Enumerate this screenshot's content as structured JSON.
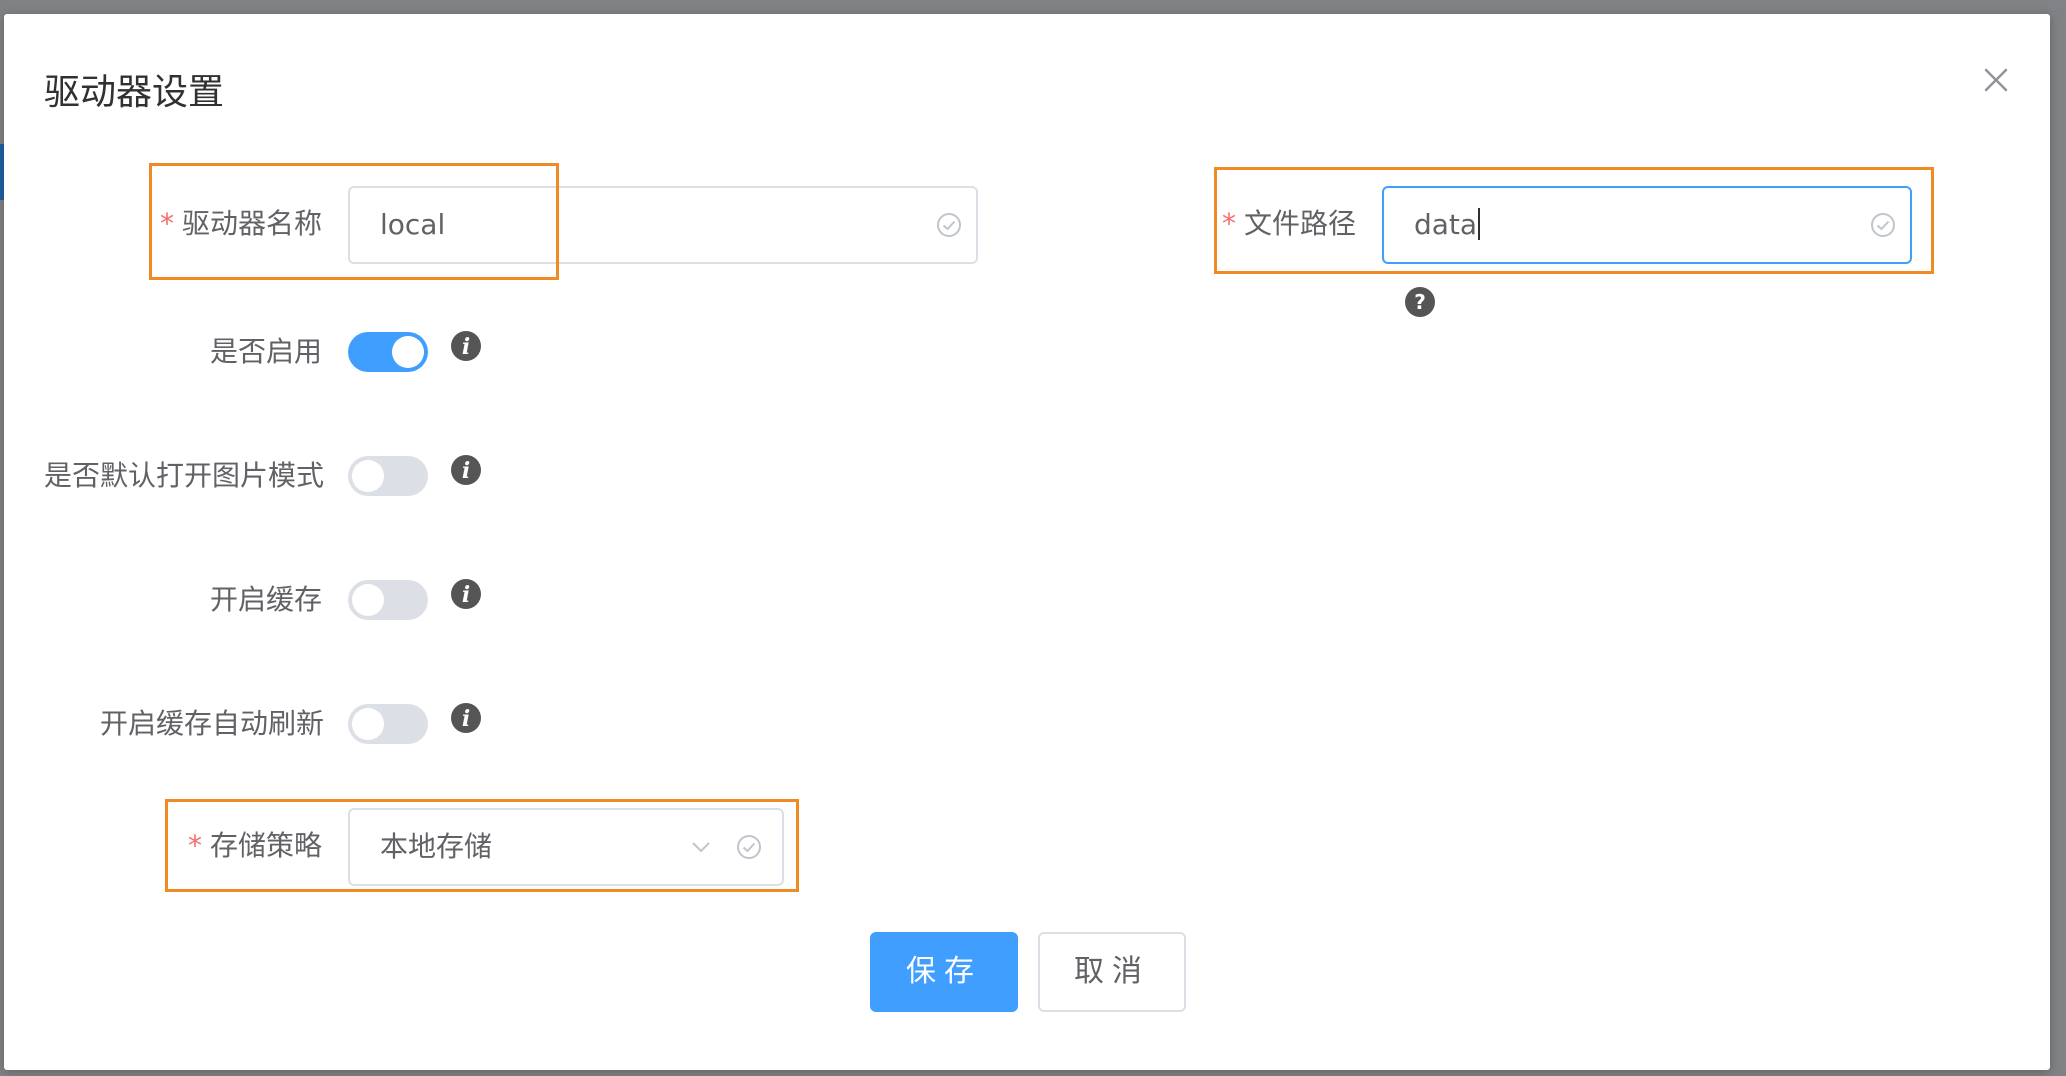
{
  "dialog": {
    "title": "驱动器设置",
    "close_icon": "close-icon"
  },
  "form": {
    "required_mark": "*",
    "driver_name": {
      "label": "驱动器名称",
      "value": "local",
      "required": true
    },
    "file_path": {
      "label": "文件路径",
      "value": "data",
      "required": true,
      "help_icon": "question-circle-icon"
    },
    "enable": {
      "label": "是否启用",
      "checked": true
    },
    "image_mode": {
      "label": "是否默认打开图片模式",
      "checked": false
    },
    "enable_cache": {
      "label": "开启缓存",
      "checked": false
    },
    "cache_auto_refresh": {
      "label": "开启缓存自动刷新",
      "checked": false
    },
    "storage_strategy": {
      "label": "存储策略",
      "value": "本地存储",
      "required": true
    }
  },
  "buttons": {
    "save_label": "保存",
    "cancel_label": "取消"
  },
  "colors": {
    "primary": "#409eff",
    "required": "#f56c6c",
    "highlight": "#f08a24",
    "valid": "#c0c4cc"
  }
}
